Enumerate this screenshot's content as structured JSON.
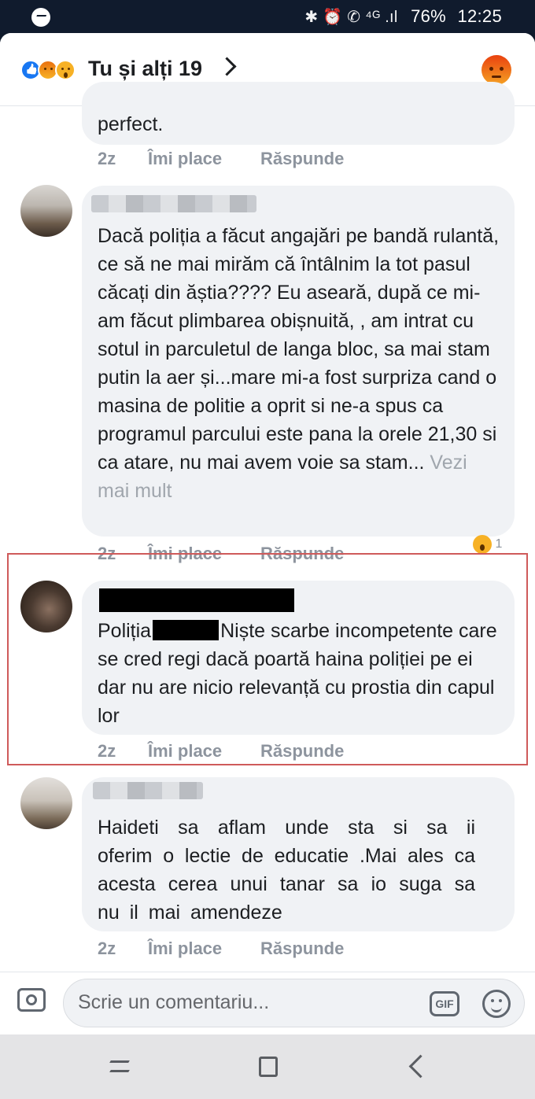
{
  "status_bar": {
    "messenger_icon": "messenger-icon",
    "icons": "✱ ⏰ ✆ ⁴ᴳ .ıl",
    "battery": "76%",
    "time": "12:25"
  },
  "header": {
    "title": "Tu și alți 19",
    "reaction_icons": [
      "like-icon",
      "angry-icon",
      "wow-icon"
    ],
    "react_button_icon": "angry-icon"
  },
  "comments": [
    {
      "text": "perfect.",
      "age": "2z",
      "like_label": "Îmi place",
      "reply_label": "Răspunde"
    },
    {
      "author_blurred": true,
      "text": "Dacă poliția a făcut angajări pe bandă rulantă, ce să ne mai mirăm că întâlnim la tot pasul căcați din ăștia???? Eu aseară, după ce mi-am făcut plimbarea obișnuită, , am intrat cu sotul in parculetul de langa bloc, sa mai stam putin la aer și...mare mi-a fost surpriza cand o masina de politie a oprit si ne-a spus ca programul parcului este pana la orele 21,30 si ca atare, nu mai avem voie sa stam...",
      "see_more": "Vezi mai mult",
      "age": "2z",
      "like_label": "Îmi place",
      "reply_label": "Răspunde",
      "reaction_count": "1"
    },
    {
      "author_redacted": true,
      "text_start": "Poliția",
      "text_rest": "Niște scarbe incompetente care se cred regi dacă poartă haina poliției pe ei dar nu are nicio relevanță cu prostia din capul lor",
      "age": "2z",
      "like_label": "Îmi place",
      "reply_label": "Răspunde"
    },
    {
      "author_blurred": true,
      "text": "Haideti sa aflam unde sta si sa ii oferim o lectie de educatie .Mai ales ca acesta cerea unui tanar sa io suga sa nu il mai amendeze",
      "age": "2z",
      "like_label": "Îmi place",
      "reply_label": "Răspunde"
    }
  ],
  "composer": {
    "placeholder": "Scrie un comentariu...",
    "gif_label": "GIF"
  }
}
